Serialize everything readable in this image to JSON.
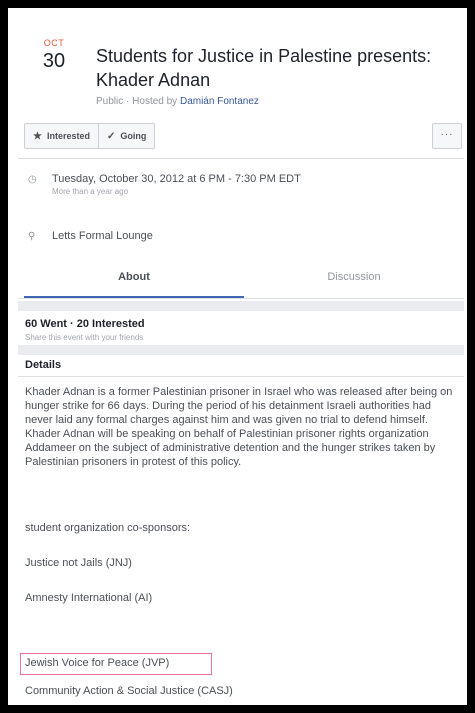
{
  "event": {
    "month": "OCT",
    "day": "30",
    "title": "Students for Justice in Palestine presents: Khader Adnan",
    "visibility": "Public",
    "separator": "·",
    "hosted_by_prefix": "Hosted by",
    "host_name": "Damián Fontanez"
  },
  "actions": {
    "interested_label": "Interested",
    "going_label": "Going",
    "more_label": "···"
  },
  "info": {
    "datetime": "Tuesday, October 30, 2012 at 6 PM - 7:30 PM EDT",
    "datetime_sub": "More than a year ago",
    "location": "Letts Formal Lounge"
  },
  "tabs": {
    "about": "About",
    "discussion": "Discussion"
  },
  "attendance": {
    "summary": "60 Went · 20 Interested",
    "share_hint": "Share this event with your friends"
  },
  "details": {
    "heading": "Details",
    "description": "Khader Adnan is a former Palestinian prisoner in Israel who was released after being on hunger strike for 66 days. During the period of his detainment Israeli authorities had never laid any formal charges against him and was given no trial to defend himself. Khader Adnan will be speaking on behalf of Palestinian prisoner rights organization Addameer on the subject of administrative detention and the hunger strikes taken by Palestinian prisoners in protest of this policy.",
    "cosponsors_heading": "student organization co-sponsors:",
    "cosponsors": [
      "Justice not Jails (JNJ)",
      "Amnesty International (AI)",
      "Jewish Voice for Peace (JVP)",
      "Community Action & Social Justice (CASJ)"
    ]
  },
  "icons": {
    "interested": "star-icon",
    "going": "checkmark-icon",
    "datetime": "clock-icon",
    "location": "map-pin-icon"
  },
  "colors": {
    "month_accent": "#e9573e",
    "host_link": "#365899",
    "tab_active_underline": "#4267b2",
    "highlight_border": "#e8729a"
  }
}
